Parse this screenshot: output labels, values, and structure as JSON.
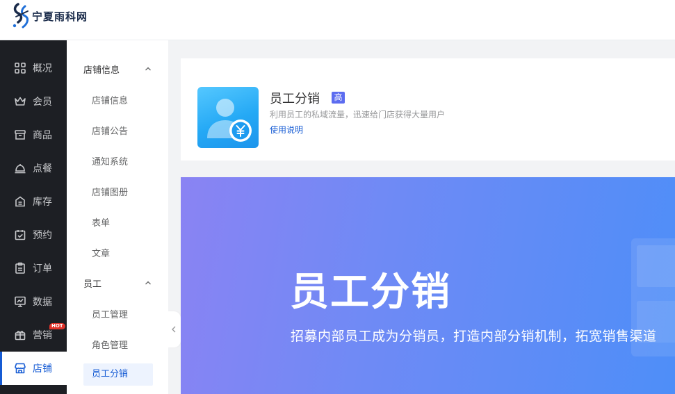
{
  "brand": {
    "name": "宁夏雨科网"
  },
  "nav": {
    "items": [
      {
        "label": "概况",
        "icon": "grid-icon"
      },
      {
        "label": "会员",
        "icon": "crown-icon"
      },
      {
        "label": "商品",
        "icon": "box-icon"
      },
      {
        "label": "点餐",
        "icon": "dish-icon"
      },
      {
        "label": "库存",
        "icon": "inventory-icon"
      },
      {
        "label": "预约",
        "icon": "calendar-check-icon"
      },
      {
        "label": "订单",
        "icon": "clipboard-icon"
      },
      {
        "label": "数据",
        "icon": "chart-monitor-icon"
      },
      {
        "label": "营销",
        "icon": "gift-icon",
        "badge": "HOT"
      },
      {
        "label": "店铺",
        "icon": "store-icon",
        "active": true
      }
    ]
  },
  "subnav": {
    "groups": [
      {
        "title": "店铺信息",
        "items": [
          "店铺信息",
          "店铺公告",
          "通知系统",
          "店铺图册",
          "表单",
          "文章"
        ]
      },
      {
        "title": "员工",
        "items": [
          "员工管理",
          "角色管理",
          "员工分销"
        ]
      }
    ],
    "active_item": "员工分销"
  },
  "app_card": {
    "title": "员工分销",
    "badge": "高",
    "description": "利用员工的私域流量，迅速给门店获得大量用户",
    "link": "使用说明"
  },
  "banner": {
    "title": "员工分销",
    "subtitle": "招募内部员工成为分销员，打造内部分销机制，拓宽销售渠道"
  },
  "colors": {
    "accent": "#155bd4",
    "nav_bg": "#1d1f24",
    "badge": "#5c6cf0",
    "hot": "#e0332a"
  }
}
